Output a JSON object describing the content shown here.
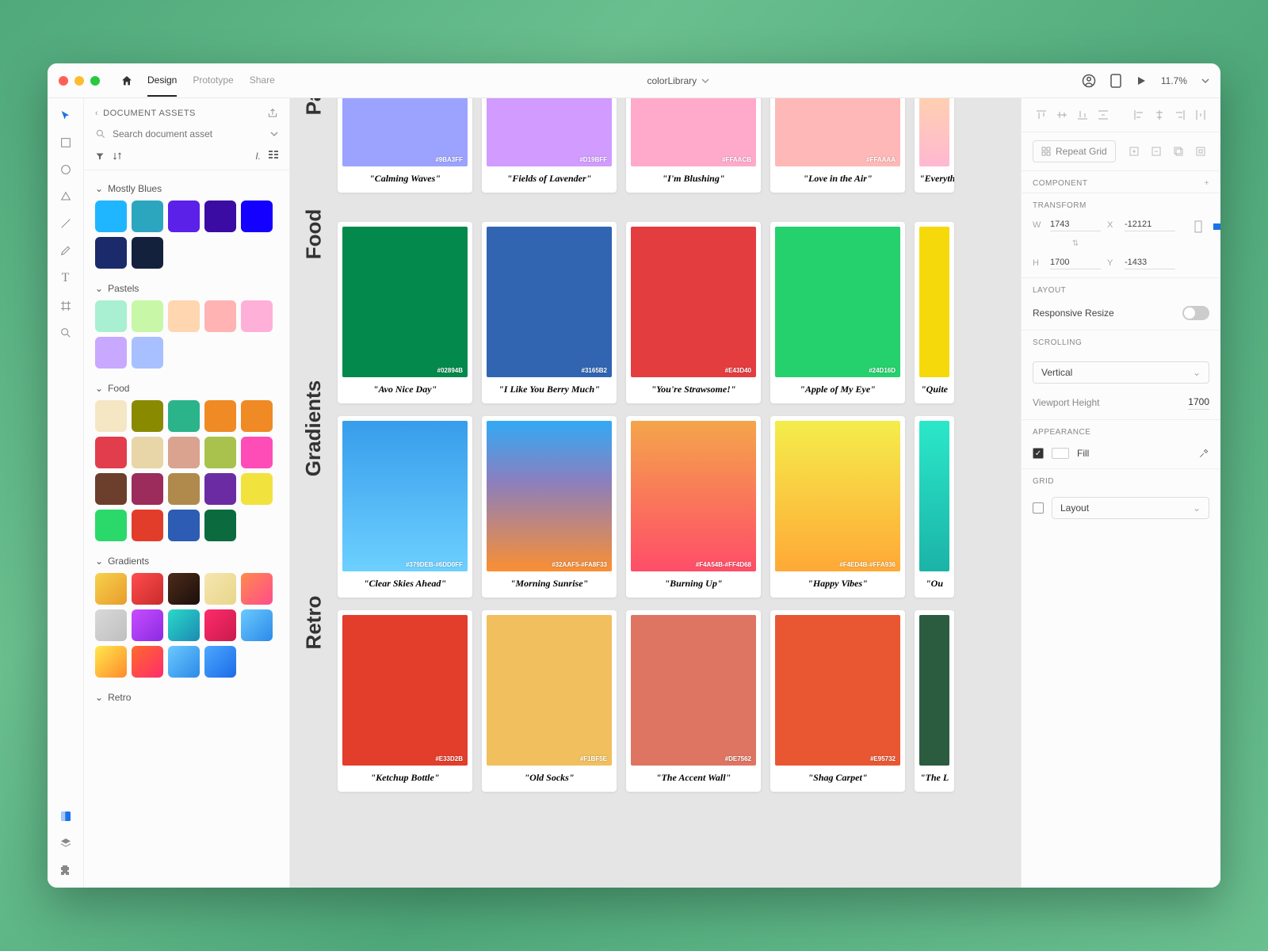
{
  "titlebar": {
    "tabs": {
      "design": "Design",
      "prototype": "Prototype",
      "share": "Share"
    },
    "doc_title": "colorLibrary",
    "zoom": "11.7%"
  },
  "assets": {
    "header": "DOCUMENT ASSETS",
    "search_placeholder": "Search document asset",
    "groups": [
      {
        "name": "Mostly Blues",
        "swatches": [
          "#1FB6FF",
          "#2CA6BF",
          "#5B21E8",
          "#3A0CA3",
          "#1400FF",
          "#1B2A6B",
          "#14213D"
        ]
      },
      {
        "name": "Pastels",
        "swatches": [
          "#A8F0D1",
          "#C8F7A8",
          "#FFD6B0",
          "#FFB3B3",
          "#FFB0D9",
          "#C9A8FF",
          "#A8C0FF"
        ]
      },
      {
        "name": "Food",
        "swatches": [
          "#F5E6C4",
          "#8A8A00",
          "#2BB38A",
          "#F08A24",
          "#F08A24",
          "#E23D4D",
          "#E8D6A8",
          "#D9A38F",
          "#A8C24D",
          "#FF4DB8",
          "#6B3F2B",
          "#9C2C5C",
          "#B08A4D",
          "#6B2CA3",
          "#F2E23D",
          "#2BD96B",
          "#E23D2B",
          "#2C5CB3",
          "#0B6B3F"
        ]
      },
      {
        "name": "Gradients",
        "swatches": [
          {
            "g": [
              "#F7D24D",
              "#E89C2B"
            ]
          },
          {
            "g": [
              "#FF4D4D",
              "#C92B2B"
            ]
          },
          {
            "g": [
              "#4D2B1B",
              "#1B0F0A"
            ]
          },
          {
            "g": [
              "#F5E6B0",
              "#E8D68A"
            ]
          },
          {
            "g": [
              "#FF8A4D",
              "#FF4D8A"
            ]
          },
          {
            "g": [
              "#D9D9D9",
              "#BFBFBF"
            ]
          },
          {
            "g": [
              "#C94DFF",
              "#8A2BE2"
            ]
          },
          {
            "g": [
              "#2BD9C9",
              "#1B8AB3"
            ]
          },
          {
            "g": [
              "#FF2B6B",
              "#C91B4D"
            ]
          },
          {
            "g": [
              "#6BC9FF",
              "#2B8AE8"
            ]
          },
          {
            "g": [
              "#FFE94D",
              "#FF8A2B"
            ]
          },
          {
            "g": [
              "#FF6B2B",
              "#FF2B6B"
            ]
          },
          {
            "g": [
              "#6BC9FF",
              "#2B8AE8"
            ]
          },
          {
            "g": [
              "#4DA8FF",
              "#1B6BE8"
            ]
          }
        ]
      },
      {
        "name": "Retro",
        "swatches": []
      }
    ]
  },
  "canvas": {
    "rows": [
      {
        "label": "Pa",
        "cards": [
          {
            "hex": "#9BA3FF",
            "title": "\"Calming Waves\"",
            "fill": "#9BA3FF"
          },
          {
            "hex": "#D19BFF",
            "title": "\"Fields of Lavender\"",
            "fill": "#D19BFF"
          },
          {
            "hex": "#FFAACB",
            "title": "\"I'm Blushing\"",
            "fill": "#FFAACB"
          },
          {
            "hex": "#FFAAAA",
            "title": "\"Love in the Air\"",
            "fill": "#FFB8B8"
          },
          {
            "hex": "",
            "title": "\"Everythi",
            "fill": "linear-gradient(180deg,#FFD6A8,#FFB8D1)"
          }
        ]
      },
      {
        "label": "Food",
        "cards": [
          {
            "hex": "#02894B",
            "title": "\"Avo Nice Day\"",
            "fill": "#02894B"
          },
          {
            "hex": "#3165B2",
            "title": "\"I Like You Berry Much\"",
            "fill": "#3165B2"
          },
          {
            "hex": "#E43D40",
            "title": "\"You're Strawsome!\"",
            "fill": "#E43D40"
          },
          {
            "hex": "#24D16D",
            "title": "\"Apple of My Eye\"",
            "fill": "#24D16D"
          },
          {
            "hex": "",
            "title": "\"Quite",
            "fill": "#F5D90A"
          }
        ]
      },
      {
        "label": "Gradients",
        "cards": [
          {
            "hex": "#379DEB-#6DD0FF",
            "title": "\"Clear Skies Ahead\"",
            "fill": "linear-gradient(180deg,#379DEB,#6DD0FF)"
          },
          {
            "hex": "#32AAF5-#FA8F33",
            "title": "\"Morning Sunrise\"",
            "fill": "linear-gradient(180deg,#32AAF5,#8A7FBF 40%,#FA8F33)"
          },
          {
            "hex": "#F4A54B-#FF4D68",
            "title": "\"Burning Up\"",
            "fill": "linear-gradient(180deg,#F4A54B,#FF4D68)"
          },
          {
            "hex": "#F4ED4B-#FFA936",
            "title": "\"Happy Vibes\"",
            "fill": "linear-gradient(180deg,#F4ED4B,#FFA936)"
          },
          {
            "hex": "",
            "title": "\"Ou",
            "fill": "linear-gradient(180deg,#2BE8C9,#1BB3A8)"
          }
        ]
      },
      {
        "label": "Retro",
        "cards": [
          {
            "hex": "#E33D2B",
            "title": "\"Ketchup Bottle\"",
            "fill": "#E33D2B"
          },
          {
            "hex": "#F1BF5E",
            "title": "\"Old Socks\"",
            "fill": "#F1BF5E"
          },
          {
            "hex": "#DE7562",
            "title": "\"The Accent Wall\"",
            "fill": "#DE7562"
          },
          {
            "hex": "#E95732",
            "title": "\"Shag Carpet\"",
            "fill": "#E95732"
          },
          {
            "hex": "",
            "title": "\"The L",
            "fill": "#2B5C3F"
          }
        ]
      }
    ]
  },
  "inspector": {
    "repeat_label": "Repeat Grid",
    "component_label": "COMPONENT",
    "transform_label": "TRANSFORM",
    "transform": {
      "w": "1743",
      "h": "1700",
      "x": "-12121",
      "y": "-1433"
    },
    "layout_label": "LAYOUT",
    "responsive_label": "Responsive Resize",
    "scrolling_label": "SCROLLING",
    "scroll_value": "Vertical",
    "viewport_label": "Viewport Height",
    "viewport_value": "1700",
    "appearance_label": "APPEARANCE",
    "fill_label": "Fill",
    "grid_label": "GRID",
    "grid_value": "Layout"
  }
}
